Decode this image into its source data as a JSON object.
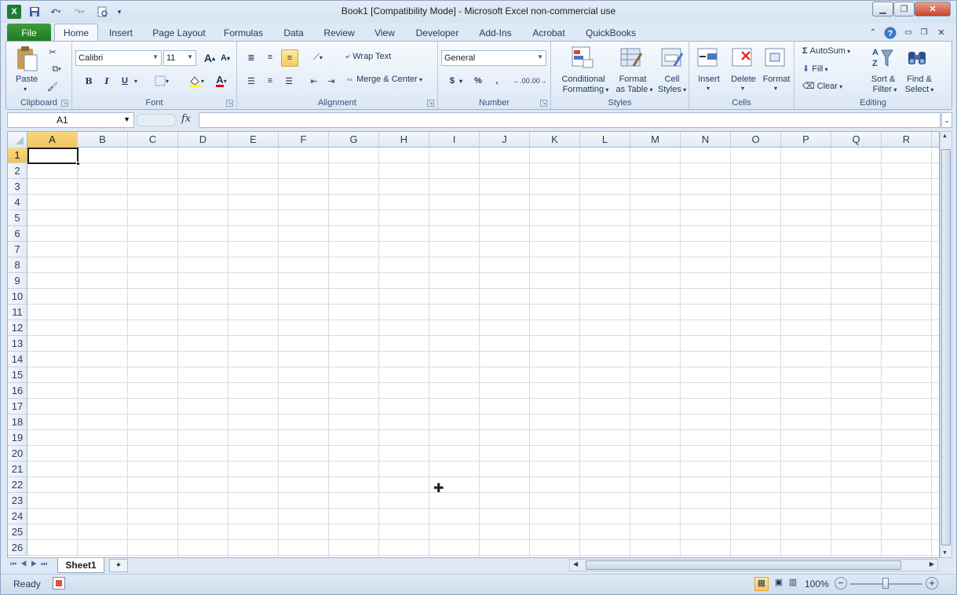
{
  "window": {
    "title": "Book1  [Compatibility Mode]  -  Microsoft Excel non-commercial use"
  },
  "tabs": [
    "File",
    "Home",
    "Insert",
    "Page Layout",
    "Formulas",
    "Data",
    "Review",
    "View",
    "Developer",
    "Add-Ins",
    "Acrobat",
    "QuickBooks"
  ],
  "ribbon": {
    "clipboard": {
      "label": "Clipboard",
      "paste": "Paste"
    },
    "font": {
      "label": "Font",
      "family": "Calibri",
      "size": "11",
      "bold": "B",
      "italic": "I",
      "underline": "U",
      "grow": "A",
      "shrink": "A",
      "color_glyph": "A"
    },
    "alignment": {
      "label": "Alignment",
      "wrap": "Wrap Text",
      "merge": "Merge & Center"
    },
    "number": {
      "label": "Number",
      "format": "General",
      "currency": "$",
      "percent": "%",
      "comma": ",",
      "inc": ".00",
      "dec": ".00"
    },
    "styles": {
      "label": "Styles",
      "conditional": "Conditional",
      "conditional2": "Formatting",
      "table": "Format",
      "table2": "as Table",
      "cell": "Cell",
      "cell2": "Styles"
    },
    "cells": {
      "label": "Cells",
      "insert": "Insert",
      "delete": "Delete",
      "format": "Format"
    },
    "editing": {
      "label": "Editing",
      "autosum": "AutoSum",
      "fill": "Fill",
      "clear": "Clear",
      "sort": "Sort &",
      "sort2": "Filter",
      "find": "Find &",
      "find2": "Select"
    }
  },
  "formula_bar": {
    "name_box": "A1",
    "fx": "fx",
    "value": ""
  },
  "columns": [
    "A",
    "B",
    "C",
    "D",
    "E",
    "F",
    "G",
    "H",
    "I",
    "J",
    "K",
    "L",
    "M",
    "N",
    "O",
    "P",
    "Q",
    "R"
  ],
  "rows": [
    "1",
    "2",
    "3",
    "4",
    "5",
    "6",
    "7",
    "8",
    "9",
    "10",
    "11",
    "12",
    "13",
    "14",
    "15",
    "16",
    "17",
    "18",
    "19",
    "20",
    "21",
    "22",
    "23",
    "24",
    "25",
    "26"
  ],
  "active_cell": "A1",
  "sheets": [
    "Sheet1"
  ],
  "status": {
    "ready": "Ready",
    "zoom": "100%"
  },
  "colors": {
    "file_tab": "#2e8b2e",
    "selected_header": "#f4c96a",
    "accent": "#1e395b"
  }
}
